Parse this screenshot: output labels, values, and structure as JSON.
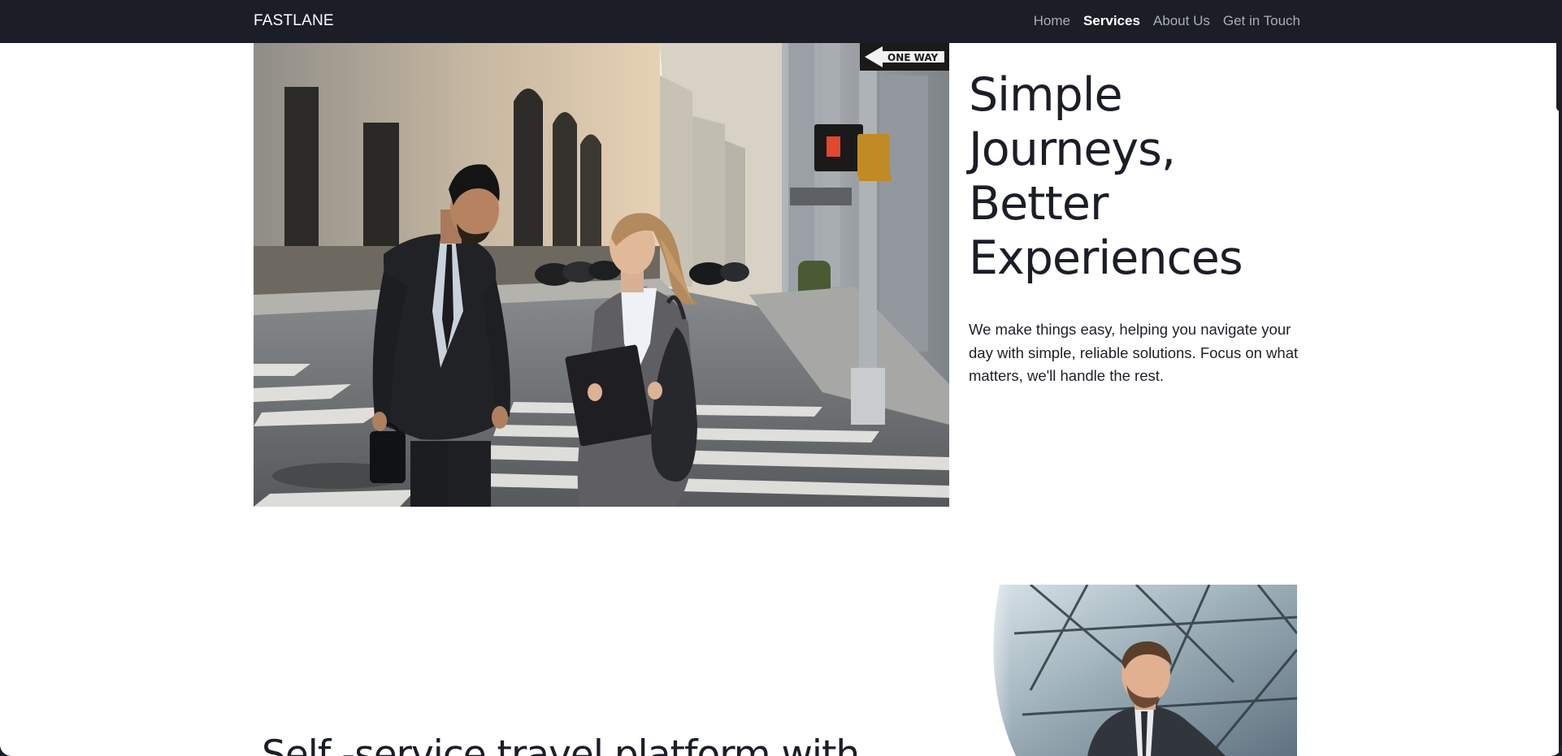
{
  "navbar": {
    "brand": "FASTLANE",
    "links": [
      {
        "label": "Home",
        "active": false
      },
      {
        "label": "Services",
        "active": true
      },
      {
        "label": "About Us",
        "active": false
      },
      {
        "label": "Get in Touch",
        "active": false
      }
    ]
  },
  "hero": {
    "title": "Simple Journeys, Better Experiences",
    "body": "We make things easy, helping you navigate your day with simple, reliable solutions. Focus on what matters, we'll handle the rest.",
    "street_sign": "ONE WAY"
  },
  "feature": {
    "title_partial": "Self -service travel platform with"
  },
  "colors": {
    "nav_bg": "#1b1e27",
    "nav_text": "#a9adb5",
    "nav_active": "#ffffff",
    "heading": "#1b1e27",
    "page_bg": "#ffffff"
  }
}
